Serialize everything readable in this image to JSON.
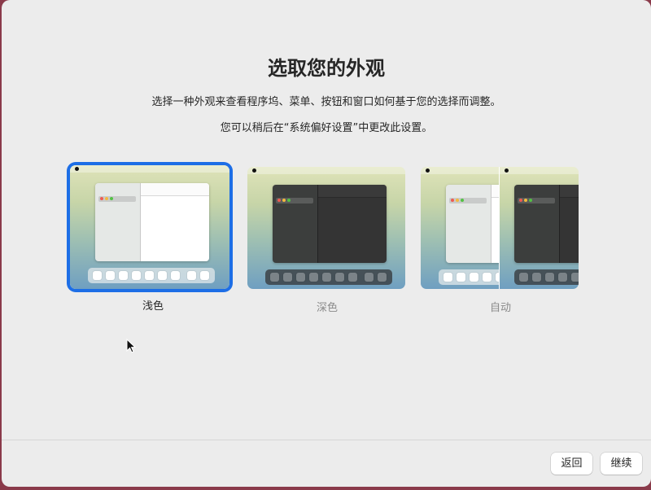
{
  "page": {
    "title": "选取您的外观",
    "description_line1": "选择一种外观来查看程序坞、菜单、按钮和窗口如何基于您的选择而调整。",
    "description_line2": "您可以稍后在“系统偏好设置”中更改此设置。"
  },
  "appearance_options": [
    {
      "label": "浅色",
      "selected": true
    },
    {
      "label": "深色",
      "selected": false
    },
    {
      "label": "自动",
      "selected": false
    }
  ],
  "buttons": {
    "back_label": "返回",
    "continue_label": "继续"
  },
  "colors": {
    "selection_accent": "#1d6ee6",
    "background": "#ececec"
  }
}
